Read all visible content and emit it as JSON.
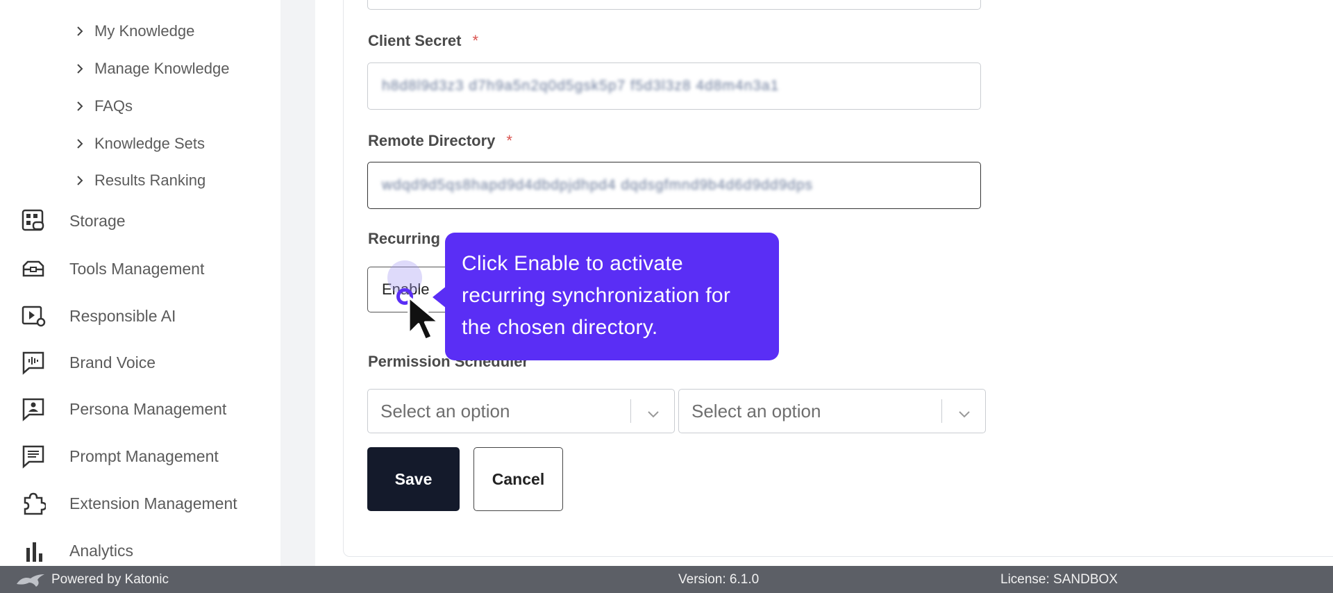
{
  "sidebar": {
    "sub_items": [
      {
        "label": "My Knowledge"
      },
      {
        "label": "Manage Knowledge"
      },
      {
        "label": "FAQs"
      },
      {
        "label": "Knowledge Sets"
      },
      {
        "label": "Results Ranking"
      }
    ],
    "nav_items": [
      {
        "label": "Storage",
        "icon": "storage-icon"
      },
      {
        "label": "Tools Management",
        "icon": "toolbox-icon"
      },
      {
        "label": "Responsible AI",
        "icon": "video-settings-icon"
      },
      {
        "label": "Brand Voice",
        "icon": "voice-icon"
      },
      {
        "label": "Persona Management",
        "icon": "persona-icon"
      },
      {
        "label": "Prompt Management",
        "icon": "prompt-icon"
      },
      {
        "label": "Extension Management",
        "icon": "puzzle-icon"
      },
      {
        "label": "Analytics",
        "icon": "bar-chart-icon"
      }
    ]
  },
  "form": {
    "client_secret": {
      "label": "Client Secret",
      "required": "*",
      "value": "h8d8l9d3z3 d7h9a5n2q0d5gsk5p7 f5d3l3z8 4d8m4n3a1"
    },
    "remote_directory": {
      "label": "Remote Directory",
      "required": "*",
      "value": "wdqd9d5qs8hapd9d4dbdpjdhpd4 dqdsgfmnd9b4d6d9dd9dps"
    },
    "recurring": {
      "label": "Recurring",
      "button_label": "Enable"
    },
    "permission_scheduler": {
      "label": "Permission Scheduler",
      "select1_placeholder": "Select an option",
      "select2_placeholder": "Select an option"
    },
    "save_label": "Save",
    "cancel_label": "Cancel"
  },
  "tooltip": {
    "text": "Click Enable to activate recurring synchronization for the chosen directory."
  },
  "footer": {
    "powered": "Powered by Katonic",
    "version": "Version: 6.1.0",
    "license": "License: SANDBOX"
  },
  "colors": {
    "accent": "#5a2ef5",
    "primary_button": "#141a2b",
    "footer_bg": "#5c5f66",
    "required": "#d9534f"
  }
}
